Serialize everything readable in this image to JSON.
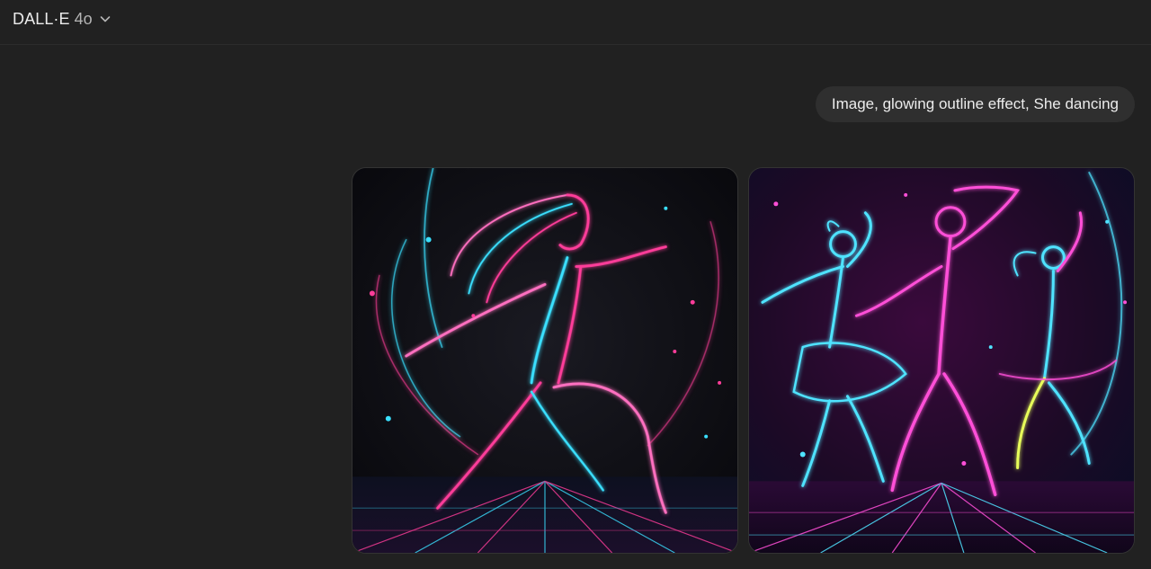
{
  "header": {
    "model_name": "DALL·E",
    "model_version": "4o",
    "dropdown_icon": "chevron-down-icon"
  },
  "conversation": {
    "user_message": "Image, glowing outline effect, She dancing"
  },
  "images": [
    {
      "description_icon": "generated-image",
      "palette": [
        "#ff3d9a",
        "#3ae0ff",
        "#0b0b10"
      ]
    },
    {
      "description_icon": "generated-image",
      "palette": [
        "#ff4fd8",
        "#4fe3ff",
        "#3a0a3c"
      ]
    }
  ]
}
